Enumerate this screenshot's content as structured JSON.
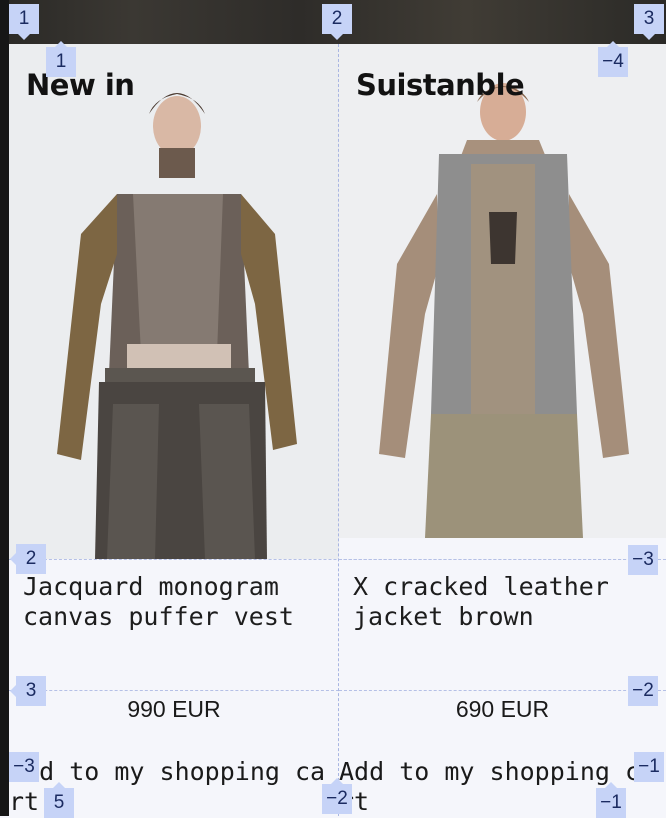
{
  "products": [
    {
      "category_label": "New in",
      "name": "Jacquard monogram canvas puffer vest",
      "price": "990 EUR",
      "add_to_cart": "Add to my shopping cart"
    },
    {
      "category_label": "Suistanble",
      "name": "X cracked leather jacket brown",
      "price": "690 EUR",
      "add_to_cart": "Add to my shopping cart"
    }
  ],
  "overlay_markers": {
    "top": [
      "1",
      "2",
      "3"
    ],
    "left_column": [
      "1",
      "2",
      "3",
      "−3",
      "5"
    ],
    "center": [
      "−2"
    ],
    "right_column": [
      "−4",
      "−3",
      "−2",
      "−1",
      "−1"
    ]
  },
  "colors": {
    "page_bg": "#f5f6fb",
    "marker_bg": "#c6d3f7",
    "marker_text": "#1b2b61",
    "guide_line": "#a9b6e2"
  }
}
